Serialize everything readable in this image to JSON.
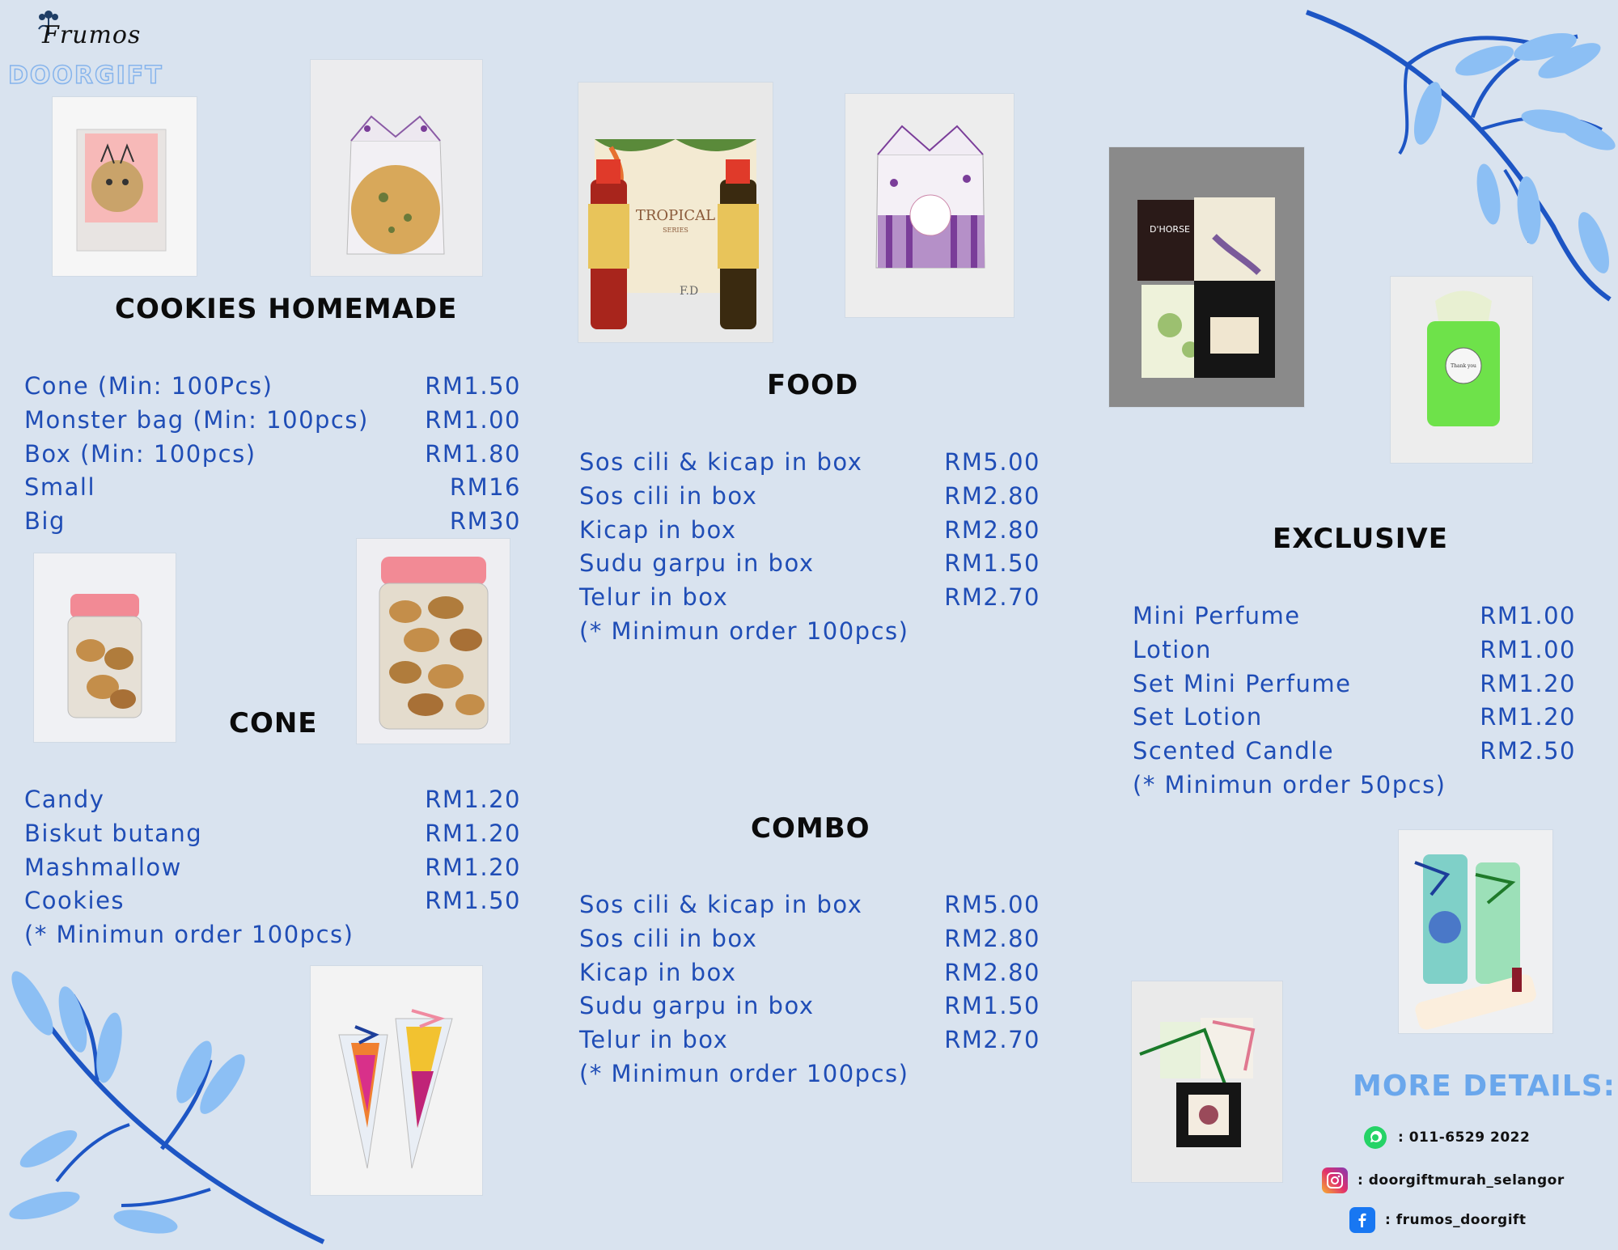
{
  "brand": {
    "script": "Frumos",
    "word": "DOORGIFT"
  },
  "sections": {
    "cookies": {
      "heading": "COOKIES HOMEMADE",
      "items": [
        {
          "name": "Cone (Min: 100Pcs)",
          "price": "RM1.50"
        },
        {
          "name": "Monster bag (Min: 100pcs)",
          "price": "RM1.00"
        },
        {
          "name": "Box (Min: 100pcs)",
          "price": "RM1.80"
        },
        {
          "name": "Small",
          "price": "RM16"
        },
        {
          "name": "Big",
          "price": "RM30"
        }
      ]
    },
    "cone": {
      "heading": "CONE",
      "items": [
        {
          "name": "Candy",
          "price": "RM1.20"
        },
        {
          "name": "Biskut butang",
          "price": "RM1.20"
        },
        {
          "name": "Mashmallow",
          "price": "RM1.20"
        },
        {
          "name": "Cookies",
          "price": "RM1.50"
        }
      ],
      "note": "(* Minimun order 100pcs)"
    },
    "food": {
      "heading": "FOOD",
      "items": [
        {
          "name": "Sos cili & kicap in box",
          "price": "RM5.00"
        },
        {
          "name": "Sos cili in box",
          "price": "RM2.80"
        },
        {
          "name": "Kicap in box",
          "price": "RM2.80"
        },
        {
          "name": "Sudu garpu in box",
          "price": "RM1.50"
        },
        {
          "name": "Telur in box",
          "price": "RM2.70"
        }
      ],
      "note": "(* Minimun order 100pcs)"
    },
    "combo": {
      "heading": "COMBO",
      "items": [
        {
          "name": "Sos cili & kicap in box",
          "price": "RM5.00"
        },
        {
          "name": "Sos cili in box",
          "price": "RM2.80"
        },
        {
          "name": "Kicap in box",
          "price": "RM2.80"
        },
        {
          "name": "Sudu garpu in box",
          "price": "RM1.50"
        },
        {
          "name": "Telur in box",
          "price": "RM2.70"
        }
      ],
      "note": "(* Minimun order 100pcs)"
    },
    "exclusive": {
      "heading": "EXCLUSIVE",
      "items": [
        {
          "name": "Mini Perfume",
          "price": "RM1.00"
        },
        {
          "name": "Lotion",
          "price": "RM1.00"
        },
        {
          "name": "Set Mini Perfume",
          "price": "RM1.20"
        },
        {
          "name": "Set Lotion",
          "price": "RM1.20"
        },
        {
          "name": "Scented Candle",
          "price": "RM2.50"
        }
      ],
      "note": "(* Minimun order 50pcs)"
    }
  },
  "contact": {
    "heading": "MORE DETAILS:",
    "whatsapp": ": 011-6529 2022",
    "instagram": ": doorgiftmurah_selangor",
    "facebook": ": frumos_doorgift"
  },
  "photo_marks": {
    "tropical": "TROPICAL",
    "series": "SERIES",
    "fd": "F.D",
    "dhorse": "D'HORSE",
    "thank_you": "Thank you"
  },
  "colors": {
    "background": "#d9e3ef",
    "price_text": "#1f4db6",
    "leaf_dark": "#1d55c4",
    "leaf_light": "#8cbff4",
    "heading_text": "#0b0b0b",
    "accent_light": "#6aa7ec"
  }
}
